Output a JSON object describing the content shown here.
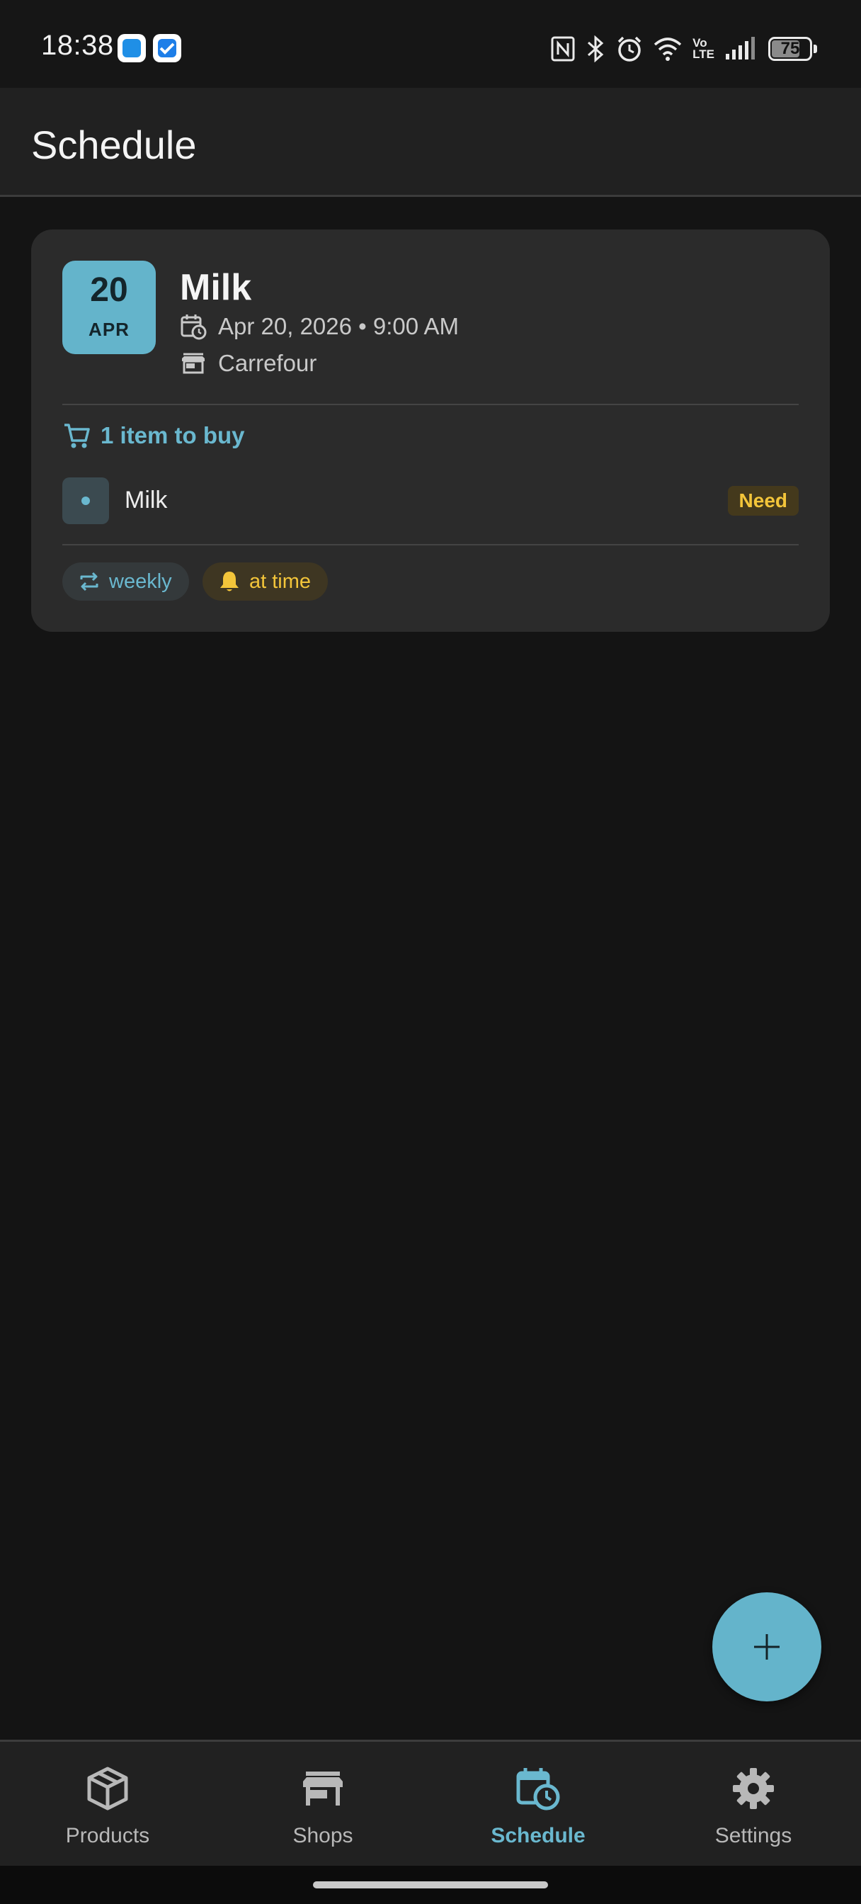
{
  "status_bar": {
    "time": "18:38",
    "battery": "75",
    "battery_level": 0.75,
    "icons": [
      "nfc-icon",
      "bluetooth-icon",
      "alarm-icon",
      "wifi-icon",
      "volte-icon",
      "signal-icon",
      "battery-icon"
    ],
    "volte_top": "Vo",
    "volte_bottom": "LTE"
  },
  "header": {
    "title": "Schedule"
  },
  "schedule": {
    "cards": [
      {
        "date_day": "20",
        "date_month": "APR",
        "title": "Milk",
        "datetime": "Apr 20, 2026 • 9:00 AM",
        "shop": "Carrefour",
        "items_summary": "1 item to buy",
        "items": [
          {
            "name": "Milk",
            "status": "Need"
          }
        ],
        "chips": {
          "repeat": "weekly",
          "reminder": "at time"
        }
      }
    ]
  },
  "fab": {
    "icon": "plus-icon"
  },
  "bottom_nav": {
    "items": [
      {
        "label": "Products",
        "icon": "cube-icon"
      },
      {
        "label": "Shops",
        "icon": "store-icon"
      },
      {
        "label": "Schedule",
        "icon": "calendar-clock-icon",
        "active": true
      },
      {
        "label": "Settings",
        "icon": "gear-icon"
      }
    ]
  },
  "colors": {
    "accent": "#64b4cb",
    "accent_text": "#6ab8cf",
    "warning": "#f3c53a",
    "background": "#141414",
    "surface": "#2b2b2b"
  }
}
